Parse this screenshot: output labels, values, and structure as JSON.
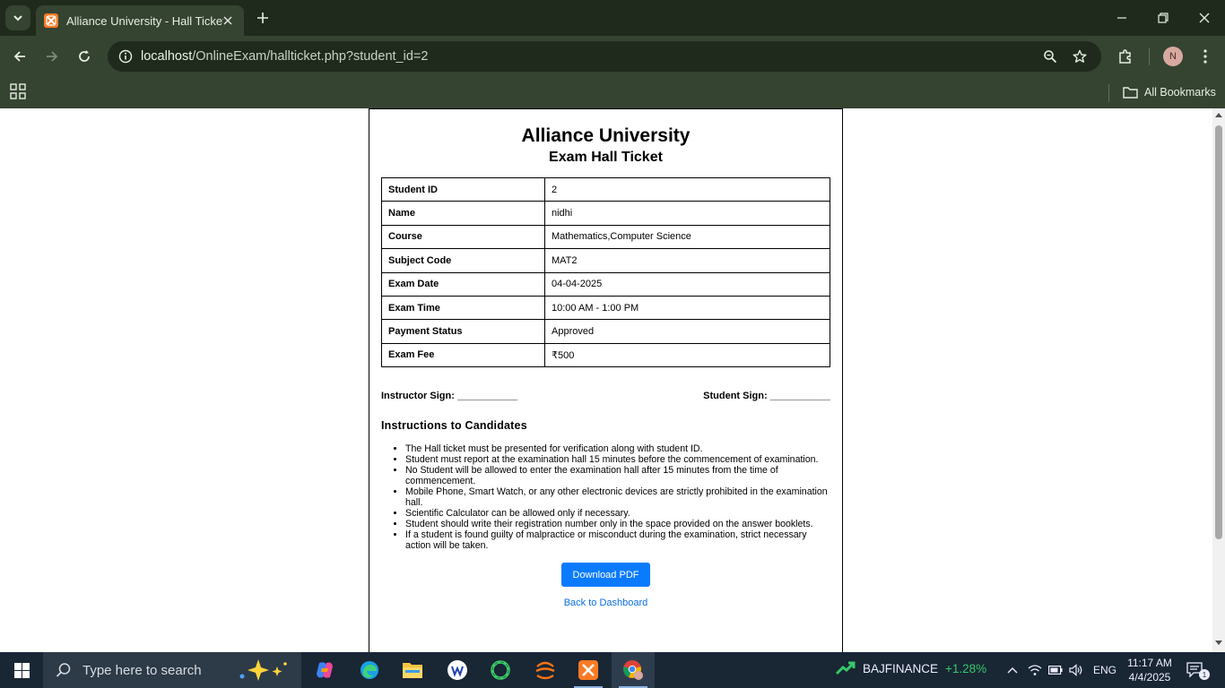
{
  "browser": {
    "tab_title": "Alliance University - Hall Ticket",
    "url_host": "localhost",
    "url_path": "/OnlineExam/hallticket.php?student_id=2",
    "profile_initial": "N",
    "all_bookmarks": "All Bookmarks"
  },
  "page": {
    "university": "Alliance University",
    "subtitle": "Exam Hall Ticket",
    "details": [
      {
        "key": "Student ID",
        "value": "2"
      },
      {
        "key": "Name",
        "value": "nidhi"
      },
      {
        "key": "Course",
        "value": "Mathematics,Computer Science"
      },
      {
        "key": "Subject Code",
        "value": "MAT2"
      },
      {
        "key": "Exam Date",
        "value": "04-04-2025"
      },
      {
        "key": "Exam Time",
        "value": "10:00 AM - 1:00 PM"
      },
      {
        "key": "Payment Status",
        "value": "Approved"
      },
      {
        "key": "Exam Fee",
        "value": "₹500"
      }
    ],
    "instructor_sign": "Instructor Sign: ___________",
    "student_sign": "Student Sign: ___________",
    "instructions_heading": "Instructions to Candidates",
    "instructions": [
      "The Hall ticket must be presented for verification along with student ID.",
      "Student must report at the examination hall 15 minutes before the commencement of examination.",
      "No Student will be allowed to enter the examination hall after 15 minutes from the time of commencement.",
      "Mobile Phone, Smart Watch, or any other electronic devices are strictly prohibited in the examination hall.",
      "Scientific Calculator can be allowed only if necessary.",
      "Student should write their registration number only in the space provided on the answer booklets.",
      "If a student is found guilty of malpractice or misconduct during the examination, strict necessary action will be taken."
    ],
    "download_button": "Download PDF",
    "back_link": "Back to Dashboard"
  },
  "taskbar": {
    "search_placeholder": "Type here to search",
    "ticker_name": "BAJFINANCE",
    "ticker_change": "+1.28%",
    "language": "ENG",
    "time": "11:17 AM",
    "date": "4/4/2025",
    "notification_count": "1"
  },
  "colors": {
    "chrome_dark": "#1f2a1c",
    "chrome_mid": "#354331",
    "button_blue": "#0a7bff",
    "link_blue": "#0a6ee0",
    "taskbar": "#192634",
    "ticker_green": "#35c96a"
  }
}
